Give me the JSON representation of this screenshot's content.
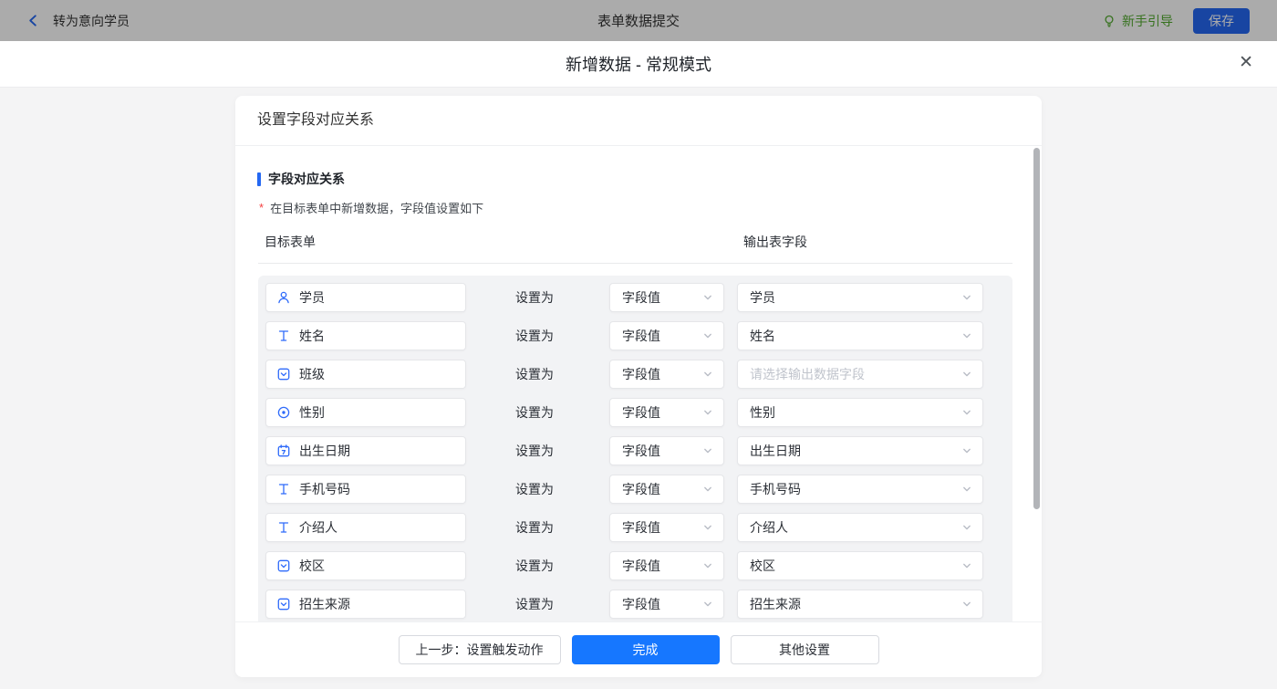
{
  "topbar": {
    "back_label": "转为意向学员",
    "title": "表单数据提交",
    "guide_label": "新手引导",
    "save_label": "保存"
  },
  "modal": {
    "title": "新增数据 - 常规模式",
    "close_glyph": "✕"
  },
  "card": {
    "header_title": "设置字段对应关系",
    "section_title": "字段对应关系",
    "required_mark": "*",
    "hint": "在目标表单中新增数据，字段值设置如下",
    "columns": {
      "left": "目标表单",
      "right": "输出表字段"
    },
    "middle_label": "设置为",
    "rows": [
      {
        "field": "学员",
        "icon": "user-icon",
        "mode": "字段值",
        "output": "学员"
      },
      {
        "field": "姓名",
        "icon": "text-icon",
        "mode": "字段值",
        "output": "姓名"
      },
      {
        "field": "班级",
        "icon": "select-icon",
        "mode": "字段值",
        "output": "",
        "output_placeholder": "请选择输出数据字段"
      },
      {
        "field": "性别",
        "icon": "radio-icon",
        "mode": "字段值",
        "output": "性别"
      },
      {
        "field": "出生日期",
        "icon": "date-icon",
        "mode": "字段值",
        "output": "出生日期"
      },
      {
        "field": "手机号码",
        "icon": "text-icon",
        "mode": "字段值",
        "output": "手机号码"
      },
      {
        "field": "介绍人",
        "icon": "text-icon",
        "mode": "字段值",
        "output": "介绍人"
      },
      {
        "field": "校区",
        "icon": "select-icon",
        "mode": "字段值",
        "output": "校区"
      },
      {
        "field": "招生来源",
        "icon": "select-icon",
        "mode": "字段值",
        "output": "招生来源"
      },
      {
        "field": "",
        "icon": null,
        "mode": "",
        "output": ""
      }
    ],
    "footer": {
      "prev_label": "上一步：设置触发动作",
      "done_label": "完成",
      "other_label": "其他设置"
    }
  },
  "colors": {
    "accent_blue": "#2468f2",
    "primary_blue": "#1677ff",
    "icon_blue": "#2f6bfa",
    "guide_green": "#52aa2f",
    "required_red": "#f53f3f",
    "placeholder_gray": "#c0c4cc",
    "panel_gray": "#f2f3f5"
  }
}
